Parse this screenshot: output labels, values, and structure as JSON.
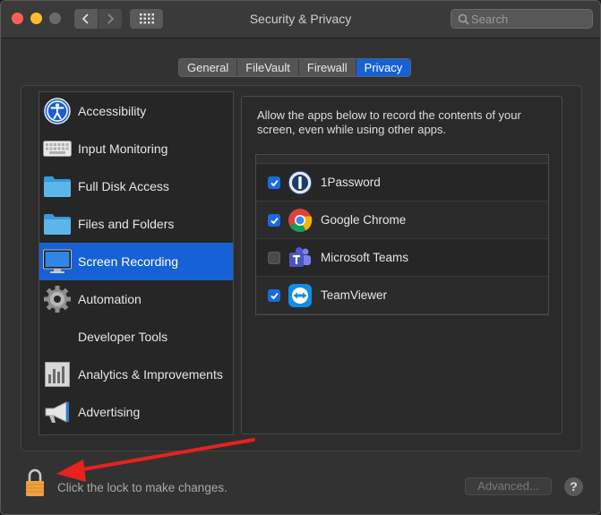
{
  "window": {
    "title": "Security & Privacy"
  },
  "search": {
    "placeholder": "Search"
  },
  "tabs": [
    {
      "label": "General"
    },
    {
      "label": "FileVault"
    },
    {
      "label": "Firewall"
    },
    {
      "label": "Privacy",
      "active": true
    }
  ],
  "sidebar": {
    "items": [
      {
        "label": "Accessibility",
        "icon": "accessibility-icon"
      },
      {
        "label": "Input Monitoring",
        "icon": "keyboard-icon"
      },
      {
        "label": "Full Disk Access",
        "icon": "folder-icon"
      },
      {
        "label": "Files and Folders",
        "icon": "folder-icon"
      },
      {
        "label": "Screen Recording",
        "icon": "display-icon",
        "selected": true
      },
      {
        "label": "Automation",
        "icon": "gear-icon"
      },
      {
        "label": "Developer Tools",
        "icon": ""
      },
      {
        "label": "Analytics & Improvements",
        "icon": "bar-chart-icon"
      },
      {
        "label": "Advertising",
        "icon": "megaphone-icon"
      }
    ]
  },
  "main": {
    "description": "Allow the apps below to record the contents of your screen, even while using other apps.",
    "apps": [
      {
        "name": "1Password",
        "checked": true,
        "icon": "1password-icon"
      },
      {
        "name": "Google Chrome",
        "checked": true,
        "icon": "chrome-icon"
      },
      {
        "name": "Microsoft Teams",
        "checked": false,
        "icon": "teams-icon"
      },
      {
        "name": "TeamViewer",
        "checked": true,
        "icon": "teamviewer-icon"
      }
    ]
  },
  "footer": {
    "lock_text": "Click the lock to make changes.",
    "advanced_label": "Advanced...",
    "help_label": "?"
  },
  "colors": {
    "accent": "#1761d6",
    "lock": "#f0a040",
    "annotation_arrow": "#e8221f"
  }
}
